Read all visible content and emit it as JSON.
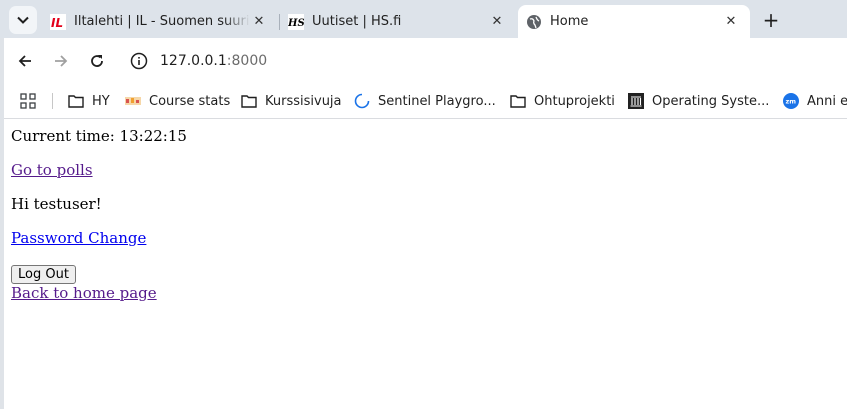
{
  "browser": {
    "tabs": [
      {
        "title": "Iltalehti | IL - Suomen suuri",
        "favicon": "IL"
      },
      {
        "title": "Uutiset | HS.fi",
        "favicon": "HS"
      },
      {
        "title": "Home",
        "favicon": "globe-icon"
      }
    ],
    "address": {
      "host": "127.0.0.1",
      "port": ":8000"
    },
    "bookmarks": [
      {
        "label": "HY",
        "icon": "folder-icon"
      },
      {
        "label": "Course stats",
        "icon": "course-stats-icon"
      },
      {
        "label": "Kurssisivuja",
        "icon": "folder-icon"
      },
      {
        "label": "Sentinel Playgro...",
        "icon": "loading-icon"
      },
      {
        "label": "Ohtuprojekti",
        "icon": "folder-icon"
      },
      {
        "label": "Operating Syste...",
        "icon": "building-icon"
      },
      {
        "label": "Anni et",
        "icon": "zm-icon"
      }
    ]
  },
  "page": {
    "current_time_label": "Current time: 13:22:15",
    "polls_link": "Go to polls",
    "greeting": "Hi testuser!",
    "password_change_link": "Password Change",
    "logout_button": "Log Out",
    "back_link": "Back to home page"
  }
}
